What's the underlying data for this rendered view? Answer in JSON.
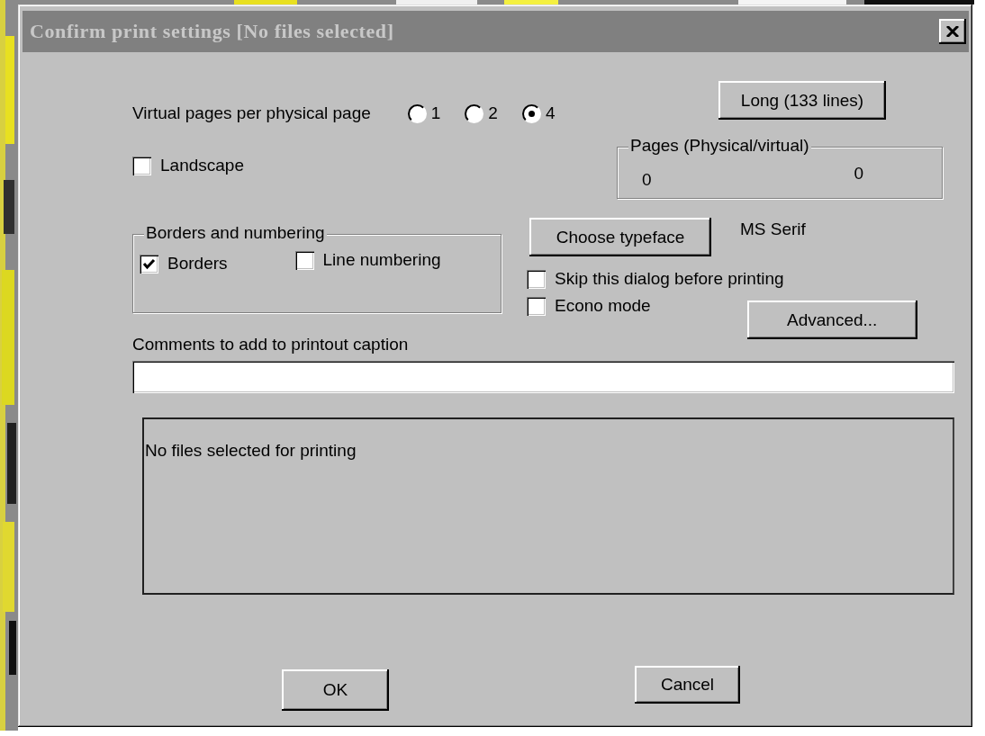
{
  "window": {
    "title": "Confirm print settings [No files selected]"
  },
  "pages_per_sheet": {
    "label": "Virtual pages per physical page",
    "options": [
      {
        "label": "1",
        "selected": false
      },
      {
        "label": "2",
        "selected": false
      },
      {
        "label": "4",
        "selected": true
      }
    ]
  },
  "length_button": "Long (133 lines)",
  "landscape": {
    "label": "Landscape",
    "checked": false
  },
  "pages_group": {
    "title": "Pages (Physical/virtual)",
    "physical": "0",
    "virtual": "0"
  },
  "borders_group": {
    "title": "Borders and numbering",
    "options": [
      {
        "label": "Borders",
        "checked": true
      },
      {
        "label": "Line numbering",
        "checked": false
      }
    ]
  },
  "typeface": {
    "button": "Choose typeface",
    "current": "MS Serif"
  },
  "options": [
    {
      "label": "Skip this dialog before printing",
      "checked": false
    },
    {
      "label": "Econo mode",
      "checked": false
    }
  ],
  "advanced_button": "Advanced...",
  "comments": {
    "label": "Comments to add to printout caption"
  },
  "file_list": {
    "message": "No files selected for printing"
  },
  "buttons": [
    "OK",
    "Cancel"
  ]
}
